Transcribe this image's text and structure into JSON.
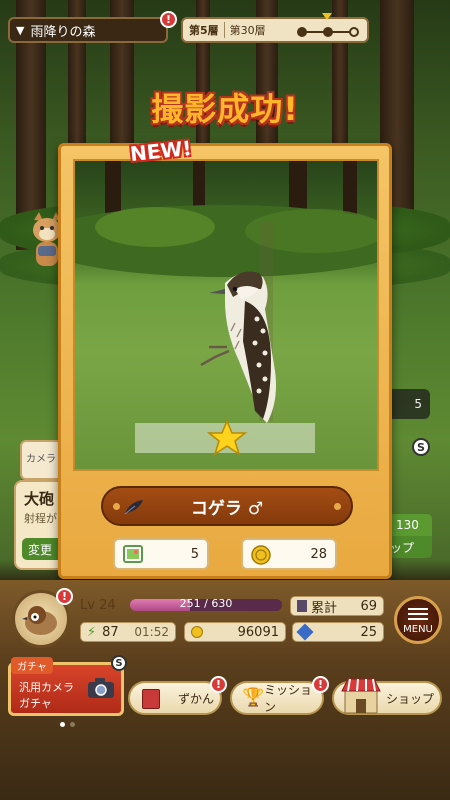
{
  "top_bar": {
    "area_name": "雨降りの森",
    "current_floor": "第5層",
    "total_floors": "第30層"
  },
  "capture": {
    "title": "撮影成功!",
    "new_tag": "NEW!",
    "bird_name": "コゲラ ♂",
    "rarity_stars": 1,
    "photo_count": "5",
    "coin_reward": "28"
  },
  "background_ui": {
    "side_value": "5",
    "camera_tab": "カメラ",
    "card_title": "大砲",
    "card_subtitle": "射程が",
    "card_button": "変更",
    "right_top": "130",
    "right_bottom": "ップ"
  },
  "player": {
    "level": "Lv 24",
    "xp_text": "251 / 630",
    "xp_fraction": 0.398,
    "total_label": "累計",
    "total_value": "69",
    "energy": "87",
    "timer": "01:52",
    "coins": "96091",
    "gems": "25",
    "menu_label": "MENU"
  },
  "nav": {
    "gacha_header": "ガチャ",
    "gacha_line1": "汎用カメラ",
    "gacha_line2": "ガチャ",
    "zukan": "ずかん",
    "mission": "ミッション",
    "shop": "ショップ"
  },
  "colors": {
    "accent_orange": "#ffb628",
    "panel_wood": "#e9a940",
    "name_bar": "#a44d14",
    "xp_pink": "#e07ab0"
  },
  "icons": [
    "triangle-down-icon",
    "alert-icon",
    "photo-icon",
    "coin-icon",
    "feather-icon",
    "star-icon",
    "book-icon",
    "trophy-icon",
    "shop-icon",
    "menu-icon",
    "camera-icon",
    "energy-icon",
    "gem-icon"
  ]
}
